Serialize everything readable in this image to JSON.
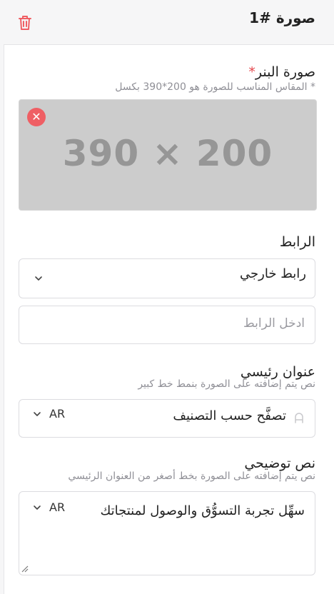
{
  "header": {
    "title": "صورة #1"
  },
  "banner": {
    "label": "صورة البنر",
    "required_mark": "*",
    "hint": "* المقاس المناسب للصورة هو 200*390 بكسل",
    "placeholder_text": "390 × 200"
  },
  "link": {
    "label": "الرابط",
    "type_value": "رابط خارجي",
    "url_placeholder": "ادخل الرابط"
  },
  "main_title": {
    "label": "عنوان رئيسي",
    "hint": "نص يتم إضافته على الصورة بنمط خط كبير",
    "value": "تصفَّح حسب التصنيف",
    "lang": "AR"
  },
  "subtitle": {
    "label": "نص توضيحي",
    "hint": "نص يتم إضافته على الصورة بخط أصغر من العنوان الرئيسي",
    "value": "سهِّل تجربة التسوُّق والوصول لمنتجاتك",
    "lang": "AR"
  },
  "colors": {
    "accent_danger": "#ef5f64",
    "header_bg": "#f6f6f7"
  }
}
